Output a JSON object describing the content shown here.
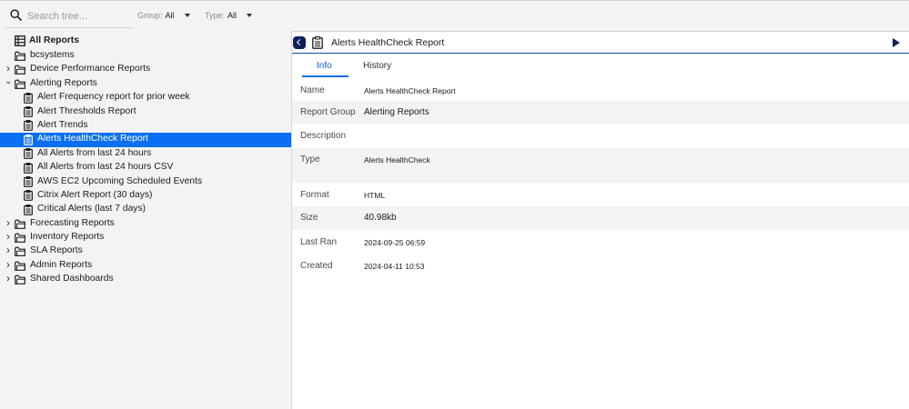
{
  "search": {
    "placeholder": "Search tree...",
    "value": ""
  },
  "filters": {
    "group_label": "Group:",
    "group_value": "All",
    "type_label": "Type:",
    "type_value": "All"
  },
  "tree": {
    "root_label": "All Reports",
    "items": [
      {
        "label": "bcsystems",
        "kind": "folder",
        "level": 0,
        "expander": ""
      },
      {
        "label": "Device Performance Reports",
        "kind": "folder",
        "level": 0,
        "expander": "collapsed"
      },
      {
        "label": "Alerting Reports",
        "kind": "folder",
        "level": 0,
        "expander": "expanded"
      },
      {
        "label": "Alert Frequency report for prior week",
        "kind": "report",
        "level": 1
      },
      {
        "label": "Alert Thresholds Report",
        "kind": "report",
        "level": 1
      },
      {
        "label": "Alert Trends",
        "kind": "report",
        "level": 1
      },
      {
        "label": "Alerts HealthCheck Report",
        "kind": "report",
        "level": 1,
        "selected": true
      },
      {
        "label": "All Alerts from last 24 hours",
        "kind": "report",
        "level": 1
      },
      {
        "label": "All Alerts from last 24 hours CSV",
        "kind": "report",
        "level": 1
      },
      {
        "label": "AWS EC2 Upcoming Scheduled Events",
        "kind": "report",
        "level": 1
      },
      {
        "label": "Citrix Alert Report (30 days)",
        "kind": "report",
        "level": 1
      },
      {
        "label": "Critical Alerts (last 7 days)",
        "kind": "report",
        "level": 1
      },
      {
        "label": "Forecasting Reports",
        "kind": "folder",
        "level": 0,
        "expander": "collapsed"
      },
      {
        "label": "Inventory Reports",
        "kind": "folder",
        "level": 0,
        "expander": "collapsed"
      },
      {
        "label": "SLA Reports",
        "kind": "folder",
        "level": 0,
        "expander": "collapsed"
      },
      {
        "label": "Admin Reports",
        "kind": "folder",
        "level": 0,
        "expander": "collapsed"
      },
      {
        "label": "Shared Dashboards",
        "kind": "folder",
        "level": 0,
        "expander": "collapsed"
      }
    ]
  },
  "detail": {
    "title": "Alerts HealthCheck Report",
    "tabs": [
      "Info",
      "History"
    ],
    "active_tab": "Info",
    "properties": [
      {
        "key": "Name",
        "value": "Alerts HealthCheck Report"
      },
      {
        "key": "Report Group",
        "value": "Alerting Reports"
      },
      {
        "key": "Description",
        "value": ""
      },
      {
        "key": "Type",
        "value": "Alerts HealthCheck"
      },
      {
        "key": "",
        "value": ""
      },
      {
        "key": "Format",
        "value": "HTML"
      },
      {
        "key": "Size",
        "value": "40.98kb"
      },
      {
        "key": "Last Ran",
        "value": "2024-09-25 06:59"
      },
      {
        "key": "Created",
        "value": "2024-04-11 10:53"
      }
    ]
  },
  "colors": {
    "accent": "#0a6ff0",
    "navy": "#0c1f5c",
    "panel_bg": "#f3f3f3"
  },
  "icons": {
    "search": "search-icon",
    "folder": "folder-icon",
    "report": "report-icon",
    "stack": "report-stack-icon",
    "back": "back-chevron-icon",
    "run": "play-icon"
  }
}
